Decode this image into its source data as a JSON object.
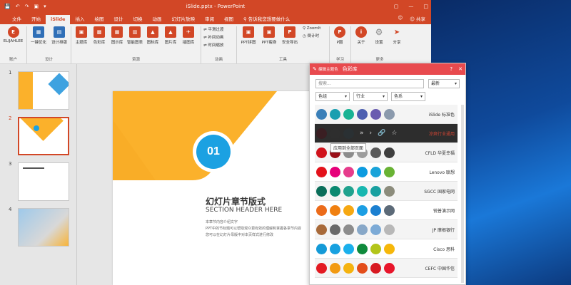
{
  "window": {
    "title": "iSlide.pptx - PowerPoint"
  },
  "titlebar": {
    "quick_access": [
      "save-icon",
      "undo-icon",
      "redo-icon",
      "present-icon",
      "dropdown-icon"
    ],
    "controls": [
      "ribbon-display-icon",
      "minimize-icon",
      "maximize-icon"
    ]
  },
  "tabs": [
    {
      "label": "文件"
    },
    {
      "label": "开始"
    },
    {
      "label": "iSlide"
    },
    {
      "label": "插入"
    },
    {
      "label": "绘图"
    },
    {
      "label": "设计"
    },
    {
      "label": "切换"
    },
    {
      "label": "动画"
    },
    {
      "label": "幻灯片放映"
    },
    {
      "label": "审阅"
    },
    {
      "label": "视图"
    },
    {
      "label": "告诉我您想要做什么"
    }
  ],
  "active_tab": "iSlide",
  "account": {
    "user": "",
    "share": "共享"
  },
  "ribbon": {
    "groups": [
      {
        "label": "账户",
        "buttons": [
          "ELIJAHLEE"
        ]
      },
      {
        "label": "设计",
        "buttons": [
          "一键优化",
          "设计排版"
        ]
      },
      {
        "label": "资源",
        "buttons": [
          "主题库",
          "色彩库",
          "图示库",
          "智能图表",
          "图标库",
          "图片库",
          "插图库"
        ]
      },
      {
        "label": "动画",
        "buttons": [
          "平滑过渡",
          "补间动画",
          "时间缩放"
        ]
      },
      {
        "label": "工具",
        "buttons": [
          "PPT拼图",
          "PPT瘦身",
          "安全导出",
          "ZoomIt",
          "倒计时"
        ]
      },
      {
        "label": "学习",
        "buttons": [
          "P圈"
        ]
      },
      {
        "label": "更多",
        "buttons": [
          "关于",
          "设置",
          "分享"
        ]
      }
    ]
  },
  "thumbnails": [
    {
      "num": "1"
    },
    {
      "num": "2"
    },
    {
      "num": "3"
    },
    {
      "num": "4"
    }
  ],
  "slide": {
    "badge": "01",
    "title_cn": "幻灯片章节版式",
    "title_en": "SECTION HEADER HERE",
    "body": [
      "本章节内容介绍文字",
      "PPT中的节标题可以帮助观众更有效的理解和掌握各章节内容",
      "您可以在幻灯片母版中对本页样式进行修改"
    ]
  },
  "panel": {
    "title": "色彩库",
    "edit_label": "编辑主题色",
    "search_placeholder": "搜索...",
    "sort": "最新",
    "filters": [
      "色组",
      "行业",
      "色系"
    ],
    "tooltip": "应用到全部页面",
    "rows": [
      {
        "name": "iSlide 标准色",
        "colors": [
          "#3a7fb8",
          "#1a9fb0",
          "#19b394",
          "#4d5fb0",
          "#6a5cb0",
          "#8b9aad"
        ]
      },
      {
        "name": "凉爽行业通用",
        "colors": [
          "#3a1e22",
          "#2e2e2e",
          "#2a3033"
        ]
      },
      {
        "name": "CFLD 华夏幸福",
        "colors": [
          "#d0121b",
          "#9a0f18",
          "#8c8c8c",
          "#9d9d9d",
          "#5a5a5a",
          "#3f3f3f"
        ]
      },
      {
        "name": "Lenovo 联想",
        "colors": [
          "#e3121b",
          "#e6007a",
          "#e63c8c",
          "#0c9be0",
          "#19a3d9",
          "#69b334"
        ]
      },
      {
        "name": "SGCC 国家电网",
        "colors": [
          "#0a6e5a",
          "#0a8870",
          "#20a28e",
          "#18b7b0",
          "#19a0a0",
          "#8c8c7c"
        ]
      },
      {
        "name": "锐普演示网",
        "colors": [
          "#ec6b1a",
          "#f08010",
          "#f6a812",
          "#1b9ee3",
          "#1b7fd0",
          "#5c6a78"
        ]
      },
      {
        "name": "JP 摩根银行",
        "colors": [
          "#a86a3a",
          "#6a6a6a",
          "#8c8c8c",
          "#88a8c8",
          "#7caad6",
          "#b8b8b8"
        ]
      },
      {
        "name": "Cisco 思科",
        "colors": [
          "#149ad7",
          "#18a1e0",
          "#1bb0ec",
          "#0f8a3c",
          "#b3c51a",
          "#f6b70a"
        ]
      },
      {
        "name": "CEFC 中国华信",
        "colors": [
          "#e31a22",
          "#f29a12",
          "#f5b30f",
          "#e34d1a",
          "#d81a22",
          "#e8152b"
        ]
      }
    ]
  }
}
